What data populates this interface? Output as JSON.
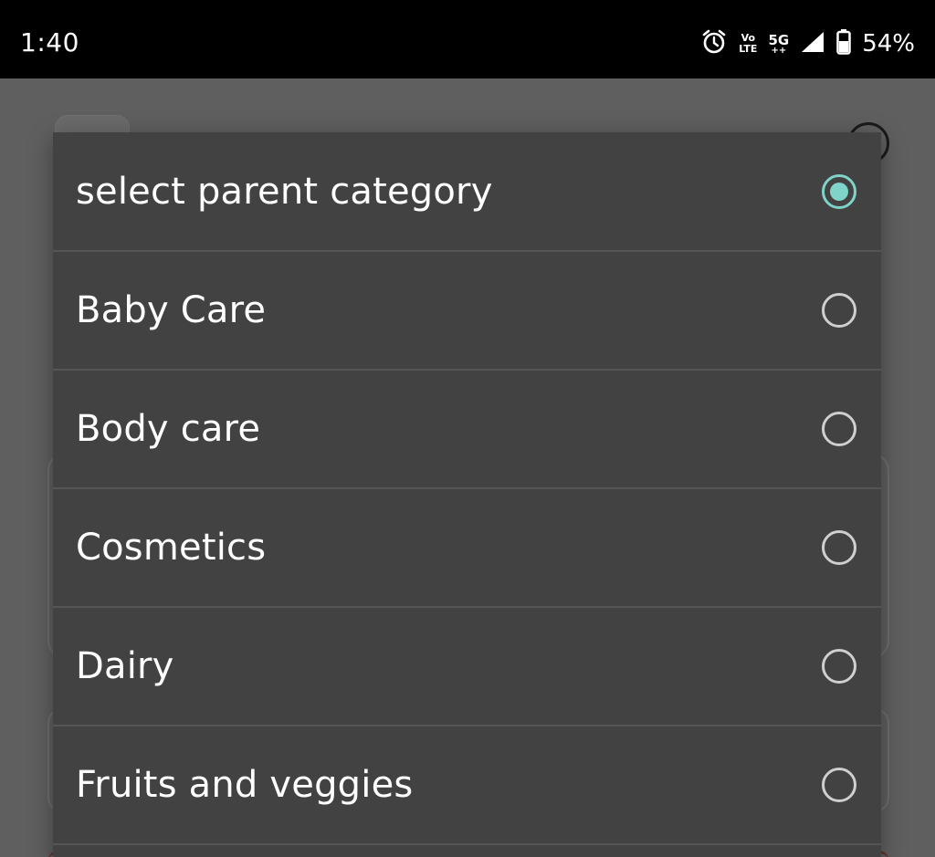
{
  "status_bar": {
    "time": "1:40",
    "volte_top": "Vo",
    "volte_bottom": "LTE",
    "network": "5G",
    "network_sub": "++",
    "battery": "54%"
  },
  "dialog": {
    "accent_color": "#7fd3c9",
    "options": [
      {
        "label": "select parent category",
        "checked": true
      },
      {
        "label": "Baby Care",
        "checked": false
      },
      {
        "label": "Body care",
        "checked": false
      },
      {
        "label": "Cosmetics",
        "checked": false
      },
      {
        "label": "Dairy",
        "checked": false
      },
      {
        "label": "Fruits and veggies",
        "checked": false
      }
    ]
  },
  "icons": {
    "alarm": "alarm-icon",
    "signal": "signal-icon",
    "battery": "battery-icon",
    "radio_checked": "radio-checked-icon",
    "radio_unchecked": "radio-unchecked-icon"
  }
}
